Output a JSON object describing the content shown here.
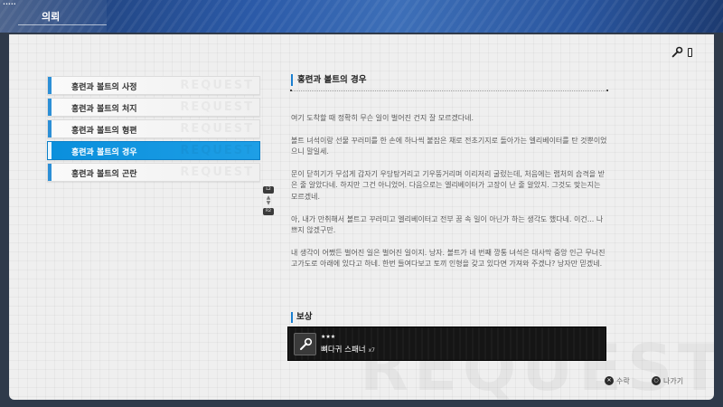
{
  "status_bar": {
    "indicator": "•••••"
  },
  "header": {
    "title": "의뢰"
  },
  "watermark": "REQUEST",
  "quests": [
    {
      "label": "홍련과 볼트의 사정",
      "selected": false
    },
    {
      "label": "홍련과 볼트의 처지",
      "selected": false
    },
    {
      "label": "홍련과 볼트의 형편",
      "selected": false
    },
    {
      "label": "홍련과 볼트의 경우",
      "selected": true
    },
    {
      "label": "홍련과 볼트의 곤란",
      "selected": false
    }
  ],
  "quest_ghost_text": "REQUEST",
  "scroll": {
    "up_button": "L2",
    "down_button": "R2"
  },
  "detail": {
    "title": "홍련과 볼트의 경우",
    "paragraphs": [
      "여기 도착할 때 정확히 무슨 일이 벌어진 건지 잘 모르겠다네.",
      "볼트 녀석이랑 선물 꾸러미를 한 손에 하나씩 붙잡은 채로 전초기지로 돌아가는 엘리베이터를 탄 것뿐이었으니 말일세.",
      "문이 닫히기가 무섭게 갑자기 우당탕거리고 기우뚱거리며 이리저리 굴렀는데, 처음에는 랩처의 습격을 받은 줄 알았다네. 하지만 그건 아니었어. 다음으로는 엘리베이터가 고장이 난 줄 알았지. 그것도 맞는지는 모르겠네.",
      "아, 내가 만취해서 볼트고 꾸러미고 엘리베이터고 전부 꿈 속 일이 아닌가 하는 생각도 했다네. 이건... 나쁘지 않겠구만.",
      "내 생각이 어쨌든 벌어진 일은 벌어진 일이지. 낭자. 볼트가 네 번째 깡통 녀석은 대사막 중앙 인근 무너진 고가도로 아래에 있다고 하네. 한번 들여다보고 토끼 인형을 갖고 있다면 가져와 주겠나? 낭자만 믿겠네."
    ]
  },
  "reward": {
    "title": "보상",
    "stars": "★★★",
    "item_name": "뼈다귀 스패너",
    "quantity": "x7",
    "icon": "wrench-icon"
  },
  "footer": {
    "accept": {
      "label": "수락",
      "button_glyph": "✕"
    },
    "back": {
      "label": "나가기",
      "button_glyph": "○"
    }
  },
  "colors": {
    "accent_blue": "#1a8fdc",
    "header_blue": "#2b5aa8",
    "panel_bg": "#efefef",
    "reward_bg": "#151515"
  }
}
